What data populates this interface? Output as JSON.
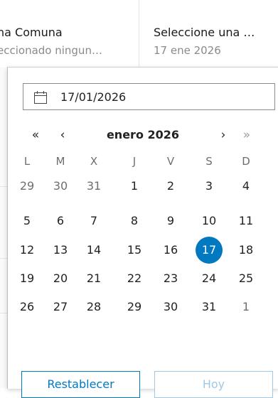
{
  "filters": [
    {
      "title": "na Comuna",
      "subtitle": "eccionado ningun…"
    },
    {
      "title": "Seleccione una …",
      "subtitle": "17 ene 2026"
    }
  ],
  "date_input": {
    "value": "17/01/2026",
    "icon": "calendar-icon"
  },
  "nav": {
    "prev_year": "«",
    "prev_month": "‹",
    "month_label": "enero 2026",
    "next_month": "›",
    "next_year": "»"
  },
  "weekdays": [
    "L",
    "M",
    "X",
    "J",
    "V",
    "S",
    "D"
  ],
  "weeks": [
    [
      "29",
      "30",
      "31",
      "1",
      "2",
      "3",
      "4"
    ],
    [
      "5",
      "6",
      "7",
      "8",
      "9",
      "10",
      "11"
    ],
    [
      "12",
      "13",
      "14",
      "15",
      "16",
      "17",
      "18"
    ],
    [
      "19",
      "20",
      "21",
      "22",
      "23",
      "24",
      "25"
    ],
    [
      "26",
      "27",
      "28",
      "29",
      "30",
      "31",
      "1"
    ]
  ],
  "selected_day": "17",
  "buttons": {
    "reset": "Restablecer",
    "today": "Hoy"
  },
  "colors": {
    "accent": "#0079c1",
    "accent_disabled": "#9fc8e6"
  }
}
